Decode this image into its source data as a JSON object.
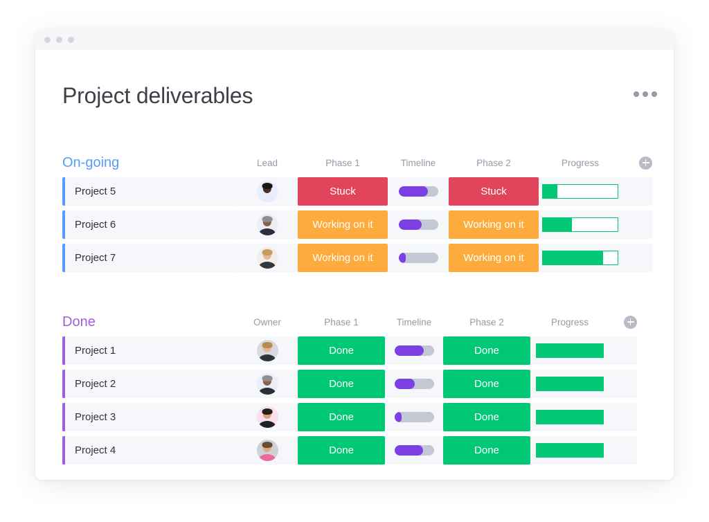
{
  "window": {
    "titlebar_dots": 3
  },
  "header": {
    "title": "Project deliverables",
    "menu_icon": "kebab-menu-icon"
  },
  "colors": {
    "stuck": "#e2445c",
    "working_on_it": "#fdab3d",
    "done": "#00c875",
    "timeline_fill": "#7b3fe4",
    "timeline_track": "#c4c7d4",
    "group_ongoing": "#579bfc",
    "group_done": "#a25ddc",
    "row_bg": "#f6f7fb",
    "title_text": "#3c4149",
    "column_header_text": "#9699a6"
  },
  "groups": [
    {
      "id": "ongoing",
      "name": "On-going",
      "color": "#579bfc",
      "columns": [
        "Lead",
        "Phase 1",
        "Timeline",
        "Phase 2",
        "Progress"
      ],
      "add_column_icon": "plus-circle-icon",
      "rows": [
        {
          "name": "Project 5",
          "avatar": {
            "name": "avatar-project-5",
            "bg": "#e8eefb",
            "skin": "#4a3026",
            "hair": "#1d1512",
            "shirt": "#e6edf6"
          },
          "phase1": {
            "label": "Stuck",
            "color": "#e2445c"
          },
          "timeline": {
            "percent": 75
          },
          "phase2": {
            "label": "Stuck",
            "color": "#e2445c"
          },
          "progress": {
            "percent": 19
          }
        },
        {
          "name": "Project 6",
          "avatar": {
            "name": "avatar-project-6",
            "bg": "#eceef5",
            "skin": "#8a6146",
            "hair": "#8e8f94",
            "shirt": "#2b2f3a"
          },
          "phase1": {
            "label": "Working on it",
            "color": "#fdab3d"
          },
          "timeline": {
            "percent": 58
          },
          "phase2": {
            "label": "Working on it",
            "color": "#fdab3d"
          },
          "progress": {
            "percent": 39
          }
        },
        {
          "name": "Project 7",
          "avatar": {
            "name": "avatar-project-7",
            "bg": "#f1eeea",
            "skin": "#e6b894",
            "hair": "#c49a5e",
            "shirt": "#33383f"
          },
          "phase1": {
            "label": "Working on it",
            "color": "#fdab3d"
          },
          "timeline": {
            "percent": 18
          },
          "phase2": {
            "label": "Working on it",
            "color": "#fdab3d"
          },
          "progress": {
            "percent": 81
          }
        }
      ]
    },
    {
      "id": "done",
      "name": "Done",
      "color": "#a25ddc",
      "columns": [
        "Owner",
        "Phase 1",
        "Timeline",
        "Phase 2",
        "Progress"
      ],
      "add_column_icon": "plus-circle-icon",
      "rows": [
        {
          "name": "Project 1",
          "avatar": {
            "name": "avatar-project-1",
            "bg": "#d8d9dc",
            "skin": "#e8b391",
            "hair": "#b58a55",
            "shirt": "#2e333b"
          },
          "phase1": {
            "label": "Done",
            "color": "#00c875"
          },
          "timeline": {
            "percent": 75
          },
          "phase2": {
            "label": "Done",
            "color": "#00c875"
          },
          "progress": {
            "percent": 100
          }
        },
        {
          "name": "Project 2",
          "avatar": {
            "name": "avatar-project-2",
            "bg": "#eceef5",
            "skin": "#8a6146",
            "hair": "#8e8f94",
            "shirt": "#2b2f3a"
          },
          "phase1": {
            "label": "Done",
            "color": "#00c875"
          },
          "timeline": {
            "percent": 52
          },
          "phase2": {
            "label": "Done",
            "color": "#00c875"
          },
          "progress": {
            "percent": 100
          }
        },
        {
          "name": "Project 3",
          "avatar": {
            "name": "avatar-project-3",
            "bg": "#fbdfeb",
            "skin": "#d8a27c",
            "hair": "#23201f",
            "shirt": "#1f2328"
          },
          "phase1": {
            "label": "Done",
            "color": "#00c875"
          },
          "timeline": {
            "percent": 18
          },
          "phase2": {
            "label": "Done",
            "color": "#00c875"
          },
          "progress": {
            "percent": 100
          }
        },
        {
          "name": "Project 4",
          "avatar": {
            "name": "avatar-project-4",
            "bg": "#cfd1d5",
            "skin": "#dca87f",
            "hair": "#6b4a32",
            "shirt": "#e86ba0"
          },
          "phase1": {
            "label": "Done",
            "color": "#00c875"
          },
          "timeline": {
            "percent": 72
          },
          "phase2": {
            "label": "Done",
            "color": "#00c875"
          },
          "progress": {
            "percent": 100
          }
        }
      ]
    }
  ]
}
